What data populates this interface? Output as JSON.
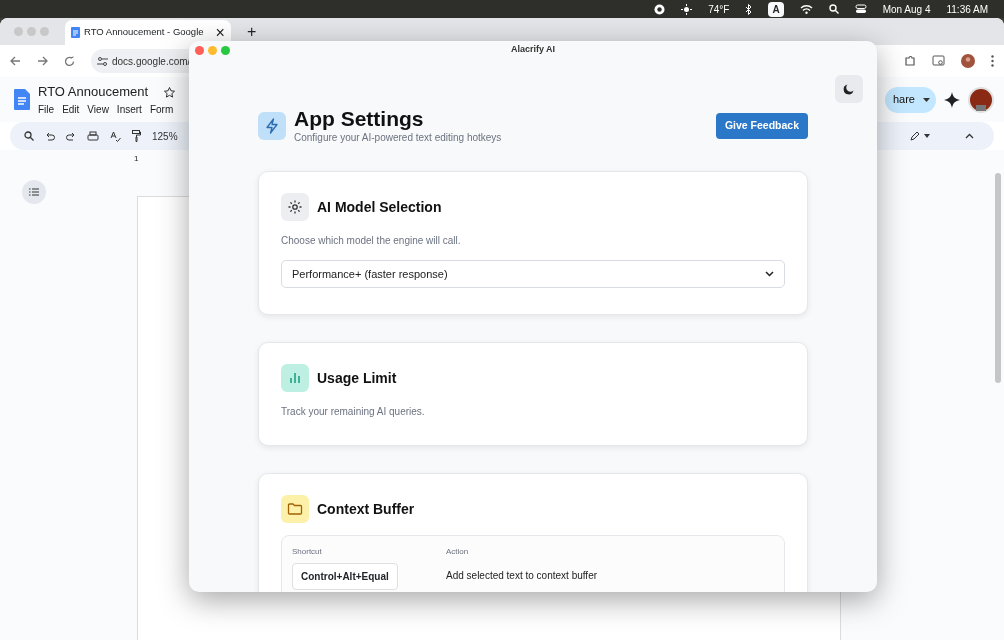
{
  "menubar": {
    "weather": "74°F",
    "input_source": "A",
    "date": "Mon Aug 4",
    "time": "11:36 AM"
  },
  "browser": {
    "tab_title": "RTO Annoucement - Google",
    "tab_close": "×",
    "new_tab": "+",
    "url": "docs.google.com/",
    "doc_title": "RTO Annoucement",
    "menus": [
      "File",
      "Edit",
      "View",
      "Insert",
      "Form"
    ],
    "zoom": "125%",
    "ruler_mark": "1",
    "share": "hare"
  },
  "app": {
    "title": "Alacrify AI",
    "heading": "App Settings",
    "subtitle": "Configure your AI-powered text editing hotkeys",
    "feedback_button": "Give Feedback",
    "sections": [
      {
        "kind": "model",
        "title": "AI Model Selection",
        "description": "Choose which model the engine will call.",
        "select_value": "Performance+ (faster response)"
      },
      {
        "kind": "usage",
        "title": "Usage Limit",
        "description": "Track your remaining AI queries."
      },
      {
        "kind": "shortcuts",
        "title": "Context Buffer",
        "columns": [
          "Shortcut",
          "Action"
        ],
        "rows": [
          {
            "shortcut": "Control+Alt+Equal",
            "action": "Add selected text to context buffer"
          }
        ]
      }
    ]
  }
}
